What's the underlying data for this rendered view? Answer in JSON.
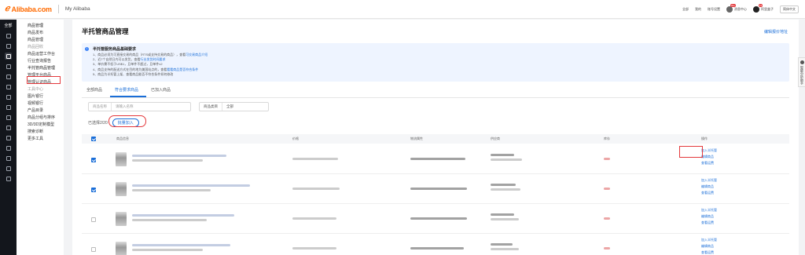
{
  "header": {
    "logo_mark": "ℯ",
    "logo_text": "Alibaba.com",
    "brand_sub": "My Alibaba",
    "links": [
      "全部",
      "我的",
      "账号设置"
    ],
    "notice_badge": "99+",
    "notice_label": "消息中心",
    "msg_badge": "13",
    "msg_label": "阿里盒子",
    "language": "简体中文"
  },
  "dark_nav": {
    "all_label": "全部",
    "icons": [
      "home-icon",
      "store-icon",
      "product-icon",
      "marketing-icon",
      "data-icon",
      "ad-icon",
      "finance-icon",
      "logistics-icon",
      "trade-icon",
      "service-icon",
      "asset-icon",
      "help-icon",
      "customs-icon",
      "account-icon",
      "apps-icon"
    ]
  },
  "side_menu": {
    "items": [
      {
        "label": "商品管理",
        "type": "heading"
      },
      {
        "label": "商品发布",
        "type": "normal"
      },
      {
        "label": "商品管理",
        "type": "normal"
      },
      {
        "label": "商品回收",
        "type": "muted"
      },
      {
        "label": "商品运营工作台",
        "type": "normal"
      },
      {
        "label": "行业查询报告",
        "type": "normal"
      },
      {
        "label": "半托管商品管理",
        "type": "active"
      },
      {
        "label": "管理平台商品",
        "type": "normal"
      },
      {
        "label": "管理认证商品",
        "type": "normal"
      },
      {
        "label": "工具中心",
        "type": "muted"
      },
      {
        "label": "图片银行",
        "type": "normal"
      },
      {
        "label": "视频银行",
        "type": "normal"
      },
      {
        "label": "产品目录",
        "type": "normal"
      },
      {
        "label": "商品分组与排序",
        "type": "normal"
      },
      {
        "label": "3D/3D定制模型",
        "type": "normal"
      },
      {
        "label": "搜索诊断",
        "type": "normal"
      },
      {
        "label": "更多工具",
        "type": "normal"
      }
    ]
  },
  "main": {
    "title": "半托管商品管理",
    "top_link": "编辑报价地址",
    "info": {
      "title": "半托管服务商品基础要求",
      "lines": [
        {
          "text": "1、商品必须为可直接交易的商品（RTS或支持交易的商品），查看",
          "link": "可交易商品介绍"
        },
        {
          "text": "2、近7个自然日内可以发货，查看",
          "link": "行业发货时间要求"
        },
        {
          "text": "3、单价需不低于US$1，且单件不超过，且单件≤2",
          "link": ""
        },
        {
          "text": "4、商品支持的配送方式在目的地为美国站点的，查看",
          "link": "看看商品是否符合条件"
        },
        {
          "text": "5、商品为半托管上架、查看商品能否不符合条件如何修改",
          "link": ""
        }
      ]
    },
    "tabs": [
      "全部商品",
      "符合要求商品",
      "已加入商品"
    ],
    "active_tab": 1,
    "filter1": {
      "seg": "商品名称",
      "placeholder": "请输入名称"
    },
    "filter2": {
      "seg": "商品类目",
      "value": "全部"
    },
    "selected_count": "已选择2/20",
    "batch_button": "批量加入",
    "columns": [
      "商品信息",
      "价格",
      "物流属性",
      "供应商",
      "库存",
      "操作"
    ],
    "rows": [
      {
        "checked": true,
        "ops": [
          "加入半托管",
          "编辑商品",
          "查看运费"
        ]
      },
      {
        "checked": true,
        "ops": [
          "加入半托管",
          "编辑商品",
          "查看运费"
        ]
      },
      {
        "checked": false,
        "ops": [
          "加入半托管",
          "编辑商品",
          "查看运费"
        ]
      },
      {
        "checked": false,
        "ops": [
          "加入半托管",
          "编辑商品",
          "查看运费"
        ]
      }
    ]
  },
  "float_tab": "智能分析助手",
  "colors": {
    "accent": "#1a6ed8",
    "brand": "#ff6a00",
    "highlight": "#e4393c"
  }
}
